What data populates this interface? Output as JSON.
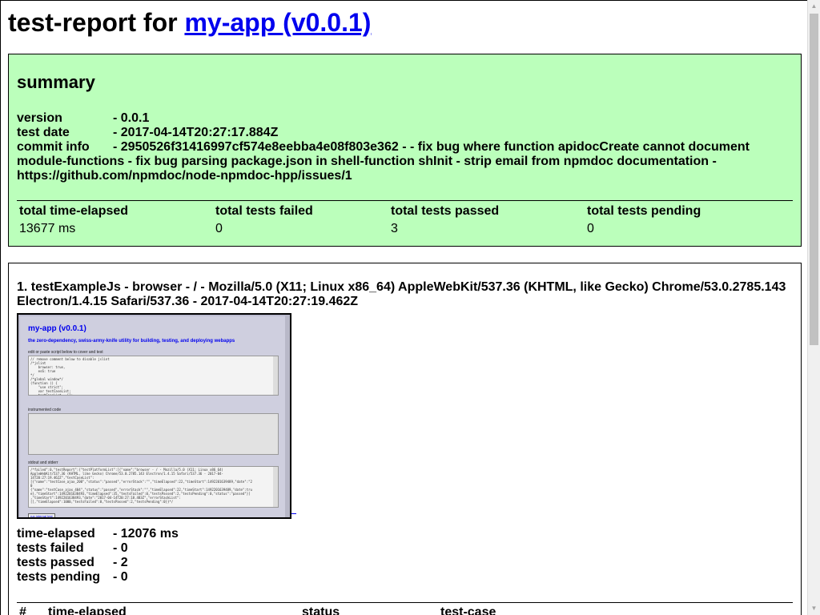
{
  "header": {
    "title_prefix": "test-report for ",
    "title_link": "my-app (v0.0.1)"
  },
  "summary": {
    "heading": "summary",
    "fields": [
      {
        "key": "version",
        "value": "- 0.0.1"
      },
      {
        "key": "test date",
        "value": "- 2017-04-14T20:27:17.884Z"
      },
      {
        "key": "commit info",
        "value": "- 2950526f31416997cf574e8eebba4e08f803e362 - - fix bug where function apidocCreate cannot document module-functions - fix bug parsing package.json in shell-function shInit - strip email from npmdoc documentation - https://github.com/npmdoc/node-npmdoc-hpp/issues/1"
      }
    ],
    "totals": {
      "time_elapsed_label": "total time-elapsed",
      "time_elapsed_value": "13677 ms",
      "failed_label": "total tests failed",
      "failed_value": "0",
      "passed_label": "total tests passed",
      "passed_value": "3",
      "pending_label": "total tests pending",
      "pending_value": "0"
    }
  },
  "test_platform": {
    "title": "1. testExampleJs - browser - / - Mozilla/5.0 (X11; Linux x86_64) AppleWebKit/537.36 (KHTML, like Gecko) Chrome/53.0.2785.143 Electron/1.4.15 Safari/537.36 - 2017-04-14T20:27:19.462Z",
    "screenshot": {
      "app_title": "my-app (v0.0.1)",
      "description": "the zero-dependency, swiss-army-knife utility for building, testing, and deploying webapps",
      "editor_label": "edit or paste script below to cover and test",
      "editor_code": "// remove comment below to disable jslint\n/*jslint\n    browser: true,\n    es6: true\n*/\n/*global window*/\n(function () {\n    \"use strict\";\n    var testCaseList;\n    testCaseList = [];",
      "instrumented_label": "instrumented code",
      "stdout_label": "stdout and stderr",
      "stdout_text": "/*failed\":0,\"testReport\":{\"testPlatformList\":[{\"name\":\"browser - / - Mozilla/5.0 (X11; Linux x86_64)\nAppleWebKit/537.36 (KHTML, like Gecko) Chrome/53.0.2785.143 Electron/1.4.15 Safari/537.36 - 2017-04-\n14T20:27:19.462Z\",\"testCaseList\":\n[{\"name\":\"testCase_ajax_200\",\"status\":\"passed\",\"errorStack\":\"\",\"timeElapsed\":22,\"timeStart\":1492201639489,\"date\":\"2\n0\n{\"name\":\"testCase_ajax_404\",\"status\":\"passed\",\"errorStack\":\"\",\"timeElapsed\":22,\"timeStart\":1492201639489,\"date\":tru\ne},\"timeStart\":1492201638493,\"timeElapsed\":35,\"testsFailed\":0,\"testsPassed\":2,\"testsPending\":0,\"status\":\"passed\"}]\n,\"timeStart\":1492201638493,\"date\":\"2017-04-14T20:27:18.483Z\",\"errorStackList\":\n[],\"timeElapsed\":1000,\"testsFailed\":0,\"testsPassed\":2,\"testsPending\":0}}*/",
      "button_label": "run internal test"
    },
    "stats": [
      {
        "key": "time-elapsed",
        "value": "- 12076 ms"
      },
      {
        "key": "tests failed",
        "value": "- 0"
      },
      {
        "key": "tests passed",
        "value": "- 2"
      },
      {
        "key": "tests pending",
        "value": "- 0"
      }
    ],
    "case_table_headers": [
      "#",
      "time-elapsed",
      "status",
      "test-case"
    ]
  },
  "colors": {
    "summary_bg": "#bbffbb",
    "link": "#0000ee"
  }
}
